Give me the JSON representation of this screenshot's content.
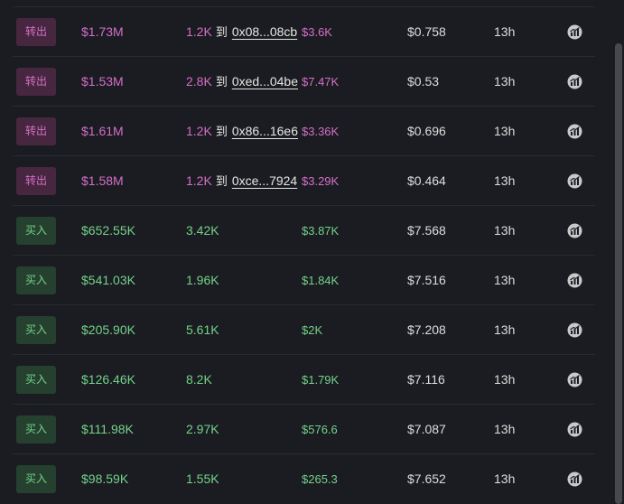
{
  "colors": {
    "sell": "#d36fc9",
    "buy": "#73d289",
    "sell_badge_bg": "#47273f",
    "buy_badge_bg": "#26402f"
  },
  "rows": [
    {
      "type": "out",
      "badge": "转出",
      "usd": "$1.73M",
      "amount": "1.2K",
      "to": "到",
      "address": "0x08...08cb",
      "value": "$3.6K",
      "price": "$0.758",
      "time": "13h",
      "icon": "chart-icon"
    },
    {
      "type": "out",
      "badge": "转出",
      "usd": "$1.53M",
      "amount": "2.8K",
      "to": "到",
      "address": "0xed...04be",
      "value": "$7.47K",
      "price": "$0.53",
      "time": "13h",
      "icon": "chart-icon"
    },
    {
      "type": "out",
      "badge": "转出",
      "usd": "$1.61M",
      "amount": "1.2K",
      "to": "到",
      "address": "0x86...16e6",
      "value": "$3.36K",
      "price": "$0.696",
      "time": "13h",
      "icon": "chart-icon"
    },
    {
      "type": "out",
      "badge": "转出",
      "usd": "$1.58M",
      "amount": "1.2K",
      "to": "到",
      "address": "0xce...7924",
      "value": "$3.29K",
      "price": "$0.464",
      "time": "13h",
      "icon": "chart-icon"
    },
    {
      "type": "in",
      "badge": "买入",
      "usd": "$652.55K",
      "amount": "3.42K",
      "value": "$3.87K",
      "price": "$7.568",
      "time": "13h",
      "icon": "chart-icon"
    },
    {
      "type": "in",
      "badge": "买入",
      "usd": "$541.03K",
      "amount": "1.96K",
      "value": "$1.84K",
      "price": "$7.516",
      "time": "13h",
      "icon": "chart-icon"
    },
    {
      "type": "in",
      "badge": "买入",
      "usd": "$205.90K",
      "amount": "5.61K",
      "value": "$2K",
      "price": "$7.208",
      "time": "13h",
      "icon": "chart-icon"
    },
    {
      "type": "in",
      "badge": "买入",
      "usd": "$126.46K",
      "amount": "8.2K",
      "value": "$1.79K",
      "price": "$7.116",
      "time": "13h",
      "icon": "chart-icon"
    },
    {
      "type": "in",
      "badge": "买入",
      "usd": "$111.98K",
      "amount": "2.97K",
      "value": "$576.6",
      "price": "$7.087",
      "time": "13h",
      "icon": "chart-icon"
    },
    {
      "type": "in",
      "badge": "买入",
      "usd": "$98.59K",
      "amount": "1.55K",
      "value": "$265.3",
      "price": "$7.652",
      "time": "13h",
      "icon": "chart-icon"
    }
  ]
}
